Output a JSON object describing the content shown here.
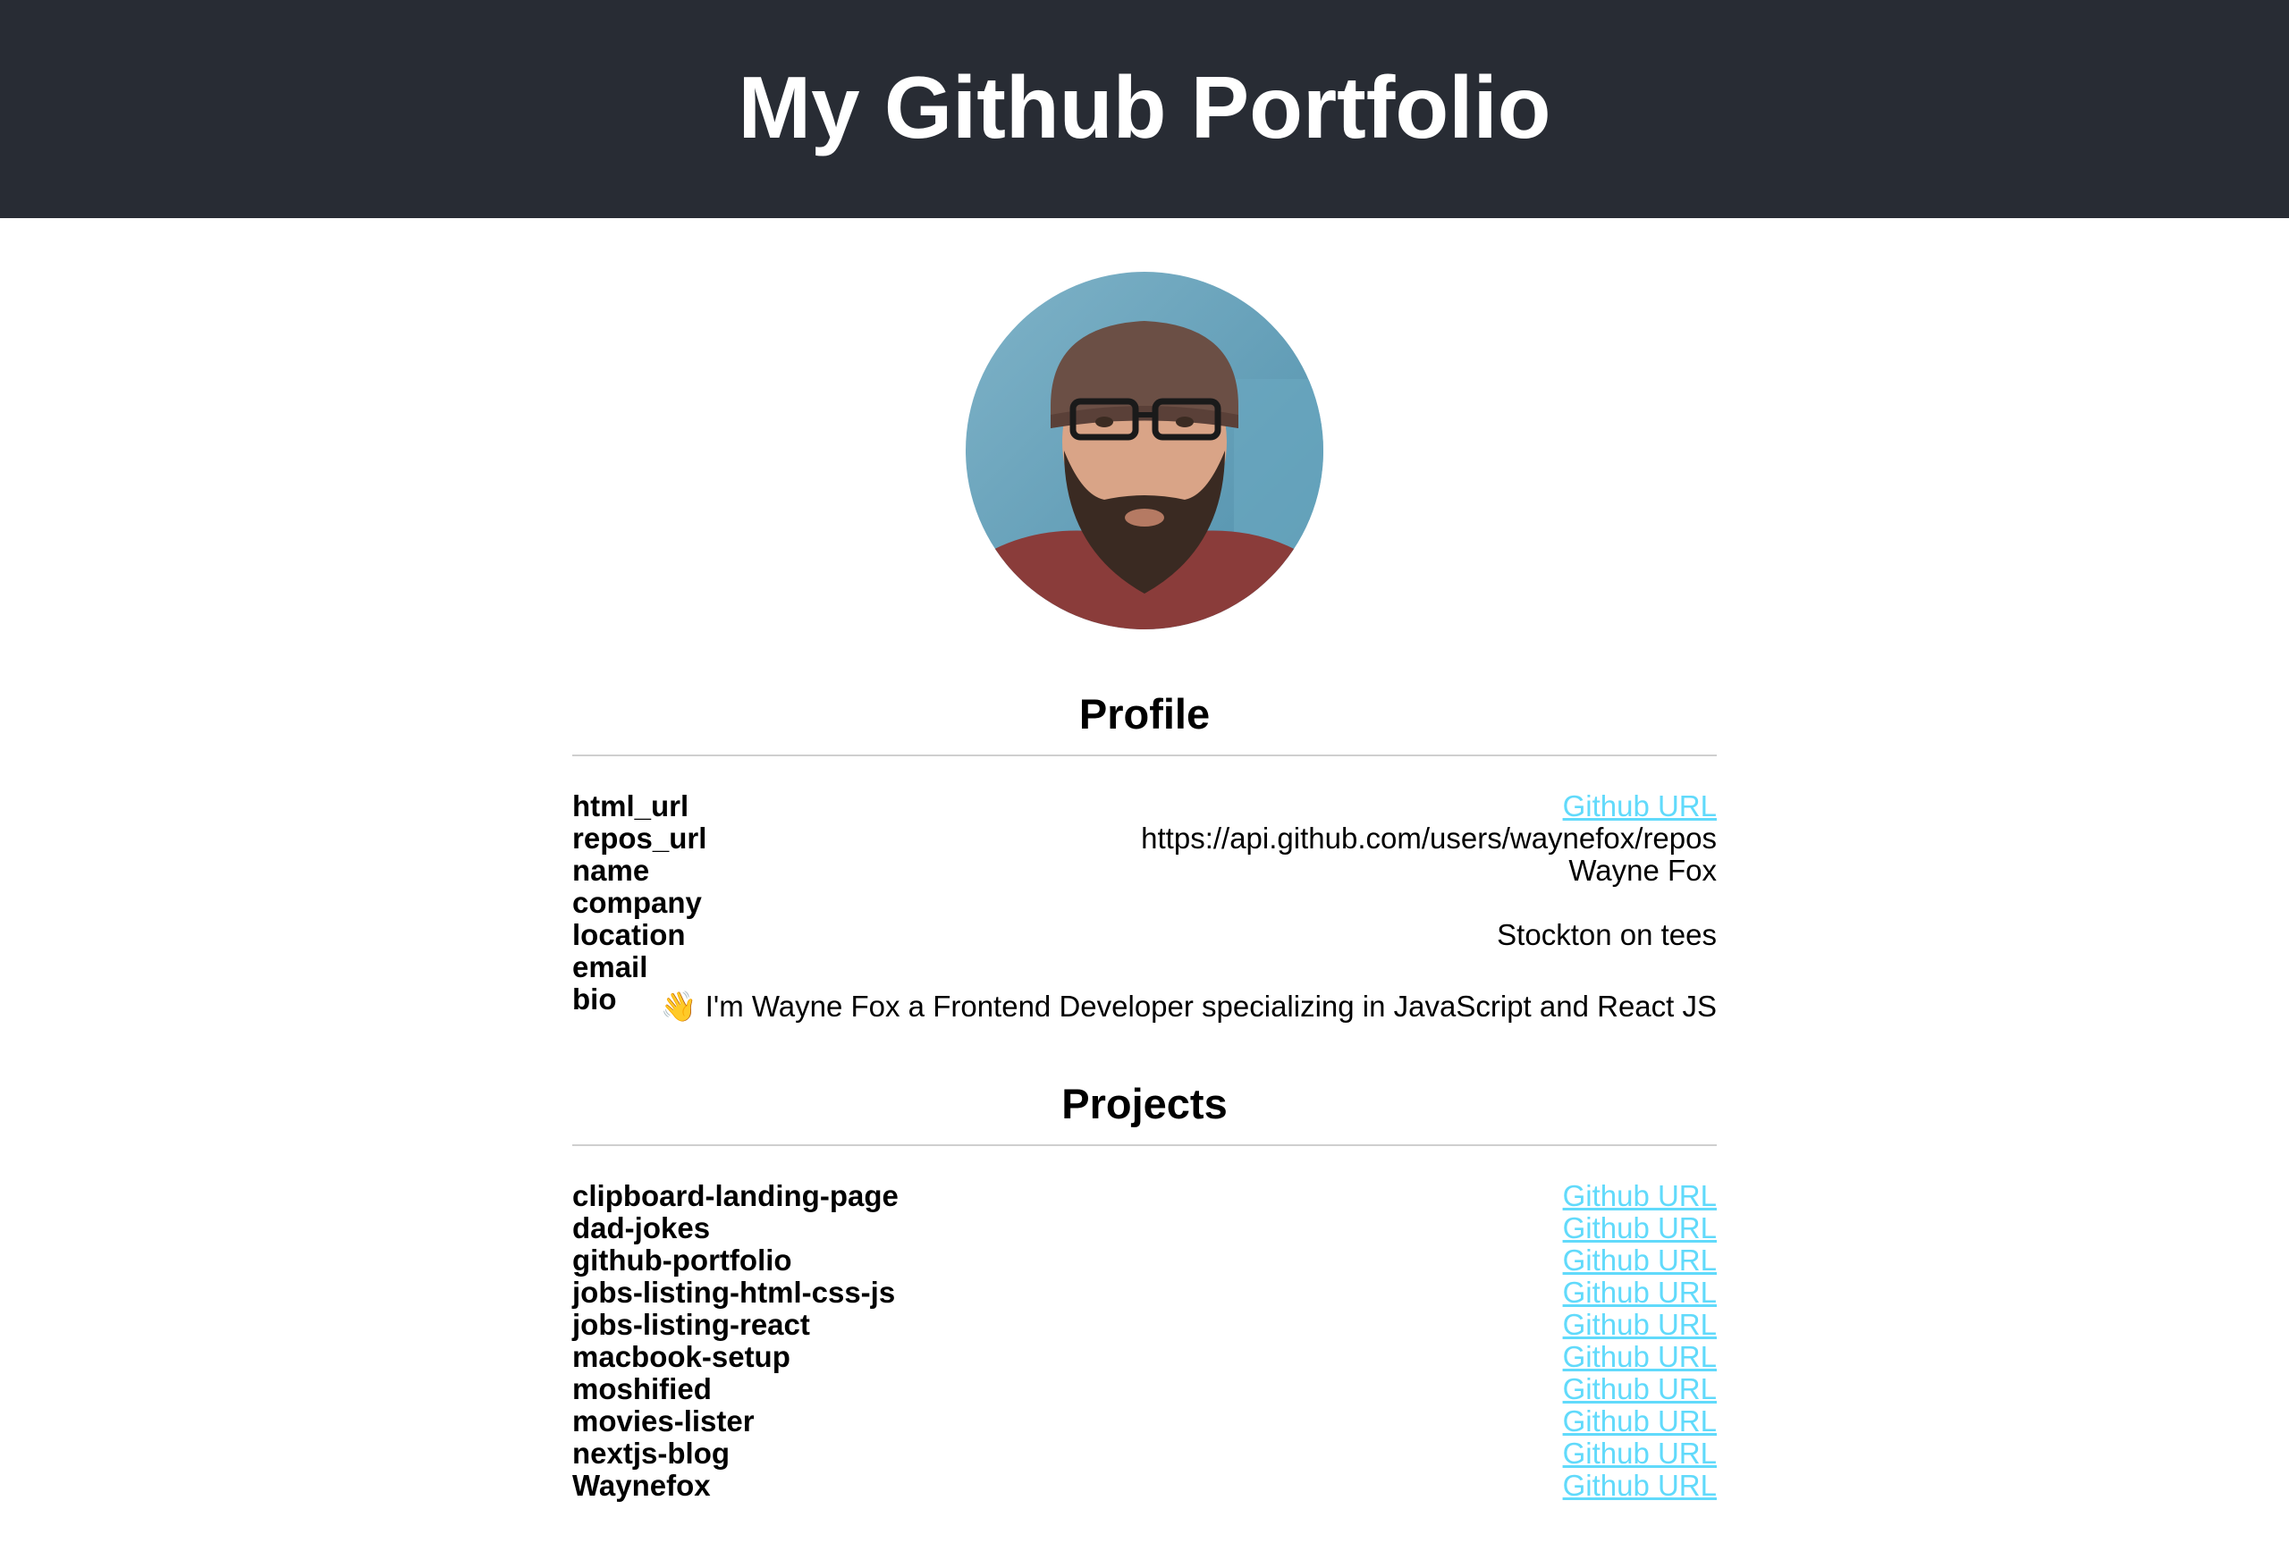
{
  "header": {
    "title": "My Github Portfolio"
  },
  "profile": {
    "title": "Profile",
    "rows": [
      {
        "key": "html_url",
        "value": "Github URL",
        "is_link": true
      },
      {
        "key": "repos_url",
        "value": "https://api.github.com/users/waynefox/repos",
        "is_link": false
      },
      {
        "key": "name",
        "value": "Wayne Fox",
        "is_link": false
      },
      {
        "key": "company",
        "value": "",
        "is_link": false
      },
      {
        "key": "location",
        "value": "Stockton on tees",
        "is_link": false
      },
      {
        "key": "email",
        "value": "",
        "is_link": false
      },
      {
        "key": "bio",
        "value": "👋 I'm Wayne Fox a Frontend Developer specializing in JavaScript and React JS",
        "is_link": false
      }
    ]
  },
  "projects": {
    "title": "Projects",
    "items": [
      {
        "name": "clipboard-landing-page",
        "link_label": "Github URL"
      },
      {
        "name": "dad-jokes",
        "link_label": "Github URL"
      },
      {
        "name": "github-portfolio",
        "link_label": "Github URL"
      },
      {
        "name": "jobs-listing-html-css-js",
        "link_label": "Github URL"
      },
      {
        "name": "jobs-listing-react",
        "link_label": "Github URL"
      },
      {
        "name": "macbook-setup",
        "link_label": "Github URL"
      },
      {
        "name": "moshified",
        "link_label": "Github URL"
      },
      {
        "name": "movies-lister",
        "link_label": "Github URL"
      },
      {
        "name": "nextjs-blog",
        "link_label": "Github URL"
      },
      {
        "name": "Waynefox",
        "link_label": "Github URL"
      }
    ]
  },
  "colors": {
    "header_bg": "#282c34",
    "link": "#61dafb",
    "rule": "#cfcfcf"
  }
}
